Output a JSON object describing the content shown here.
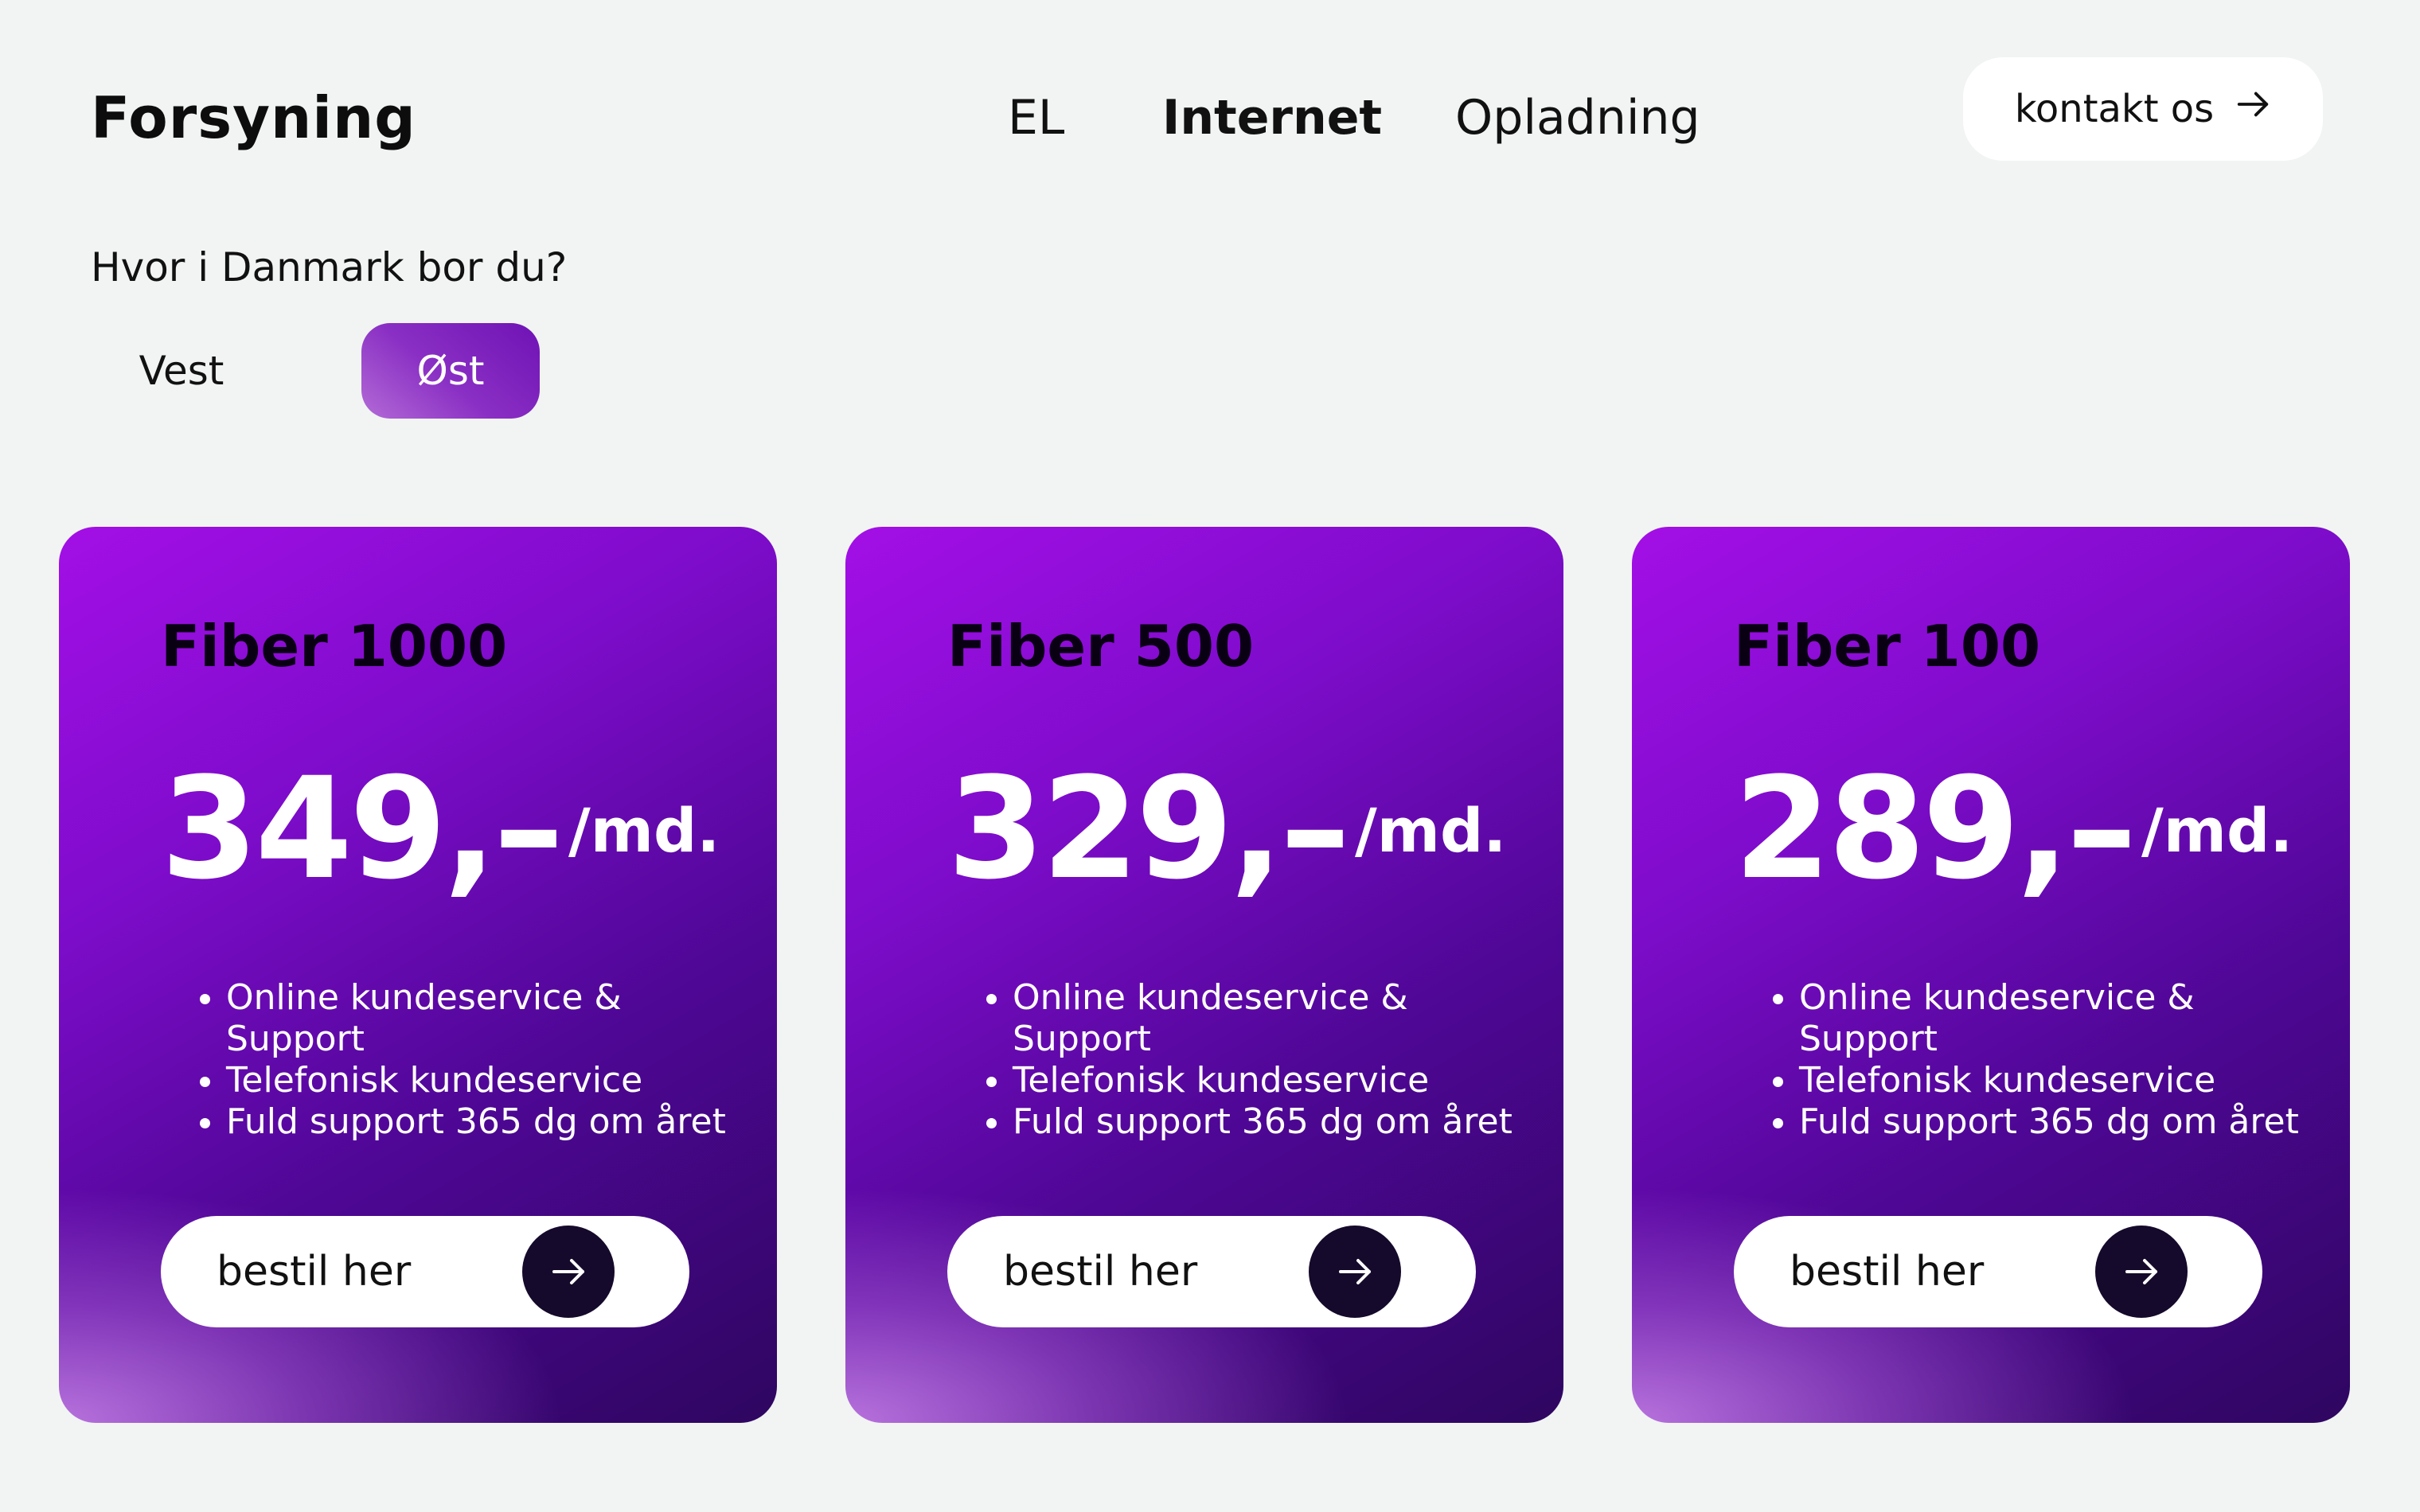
{
  "header": {
    "logo": "Forsyning",
    "nav": [
      {
        "label": "EL",
        "active": false
      },
      {
        "label": "Internet",
        "active": true
      },
      {
        "label": "Opladning",
        "active": false
      }
    ],
    "contact_label": "kontakt os",
    "contact_icon": "arrow-right-icon"
  },
  "region_picker": {
    "question": "Hvor i Danmark bor du?",
    "options": [
      {
        "label": "Vest",
        "selected": false
      },
      {
        "label": "Øst",
        "selected": true
      }
    ]
  },
  "colors": {
    "background": "#f1f4f3",
    "card_gradient_start": "#a30fe6",
    "card_gradient_end": "#2e0660",
    "arrow_circle": "#150a2b",
    "selected_pill": "#8a2fc4"
  },
  "plans": [
    {
      "title": "Fiber 1000",
      "price": "349,–",
      "period": "/md.",
      "features": [
        "Online kundeservice & Support",
        "Telefonisk kundeservice",
        "Fuld support 365 dg om året"
      ],
      "cta": "bestil her",
      "cta_icon": "arrow-right-icon"
    },
    {
      "title": "Fiber 500",
      "price": "329,–",
      "period": "/md.",
      "features": [
        "Online kundeservice & Support",
        "Telefonisk kundeservice",
        "Fuld support 365 dg om året"
      ],
      "cta": "bestil her",
      "cta_icon": "arrow-right-icon"
    },
    {
      "title": "Fiber 100",
      "price": "289,–",
      "period": "/md.",
      "features": [
        "Online kundeservice & Support",
        "Telefonisk kundeservice",
        "Fuld support 365 dg om året"
      ],
      "cta": "bestil her",
      "cta_icon": "arrow-right-icon"
    }
  ]
}
